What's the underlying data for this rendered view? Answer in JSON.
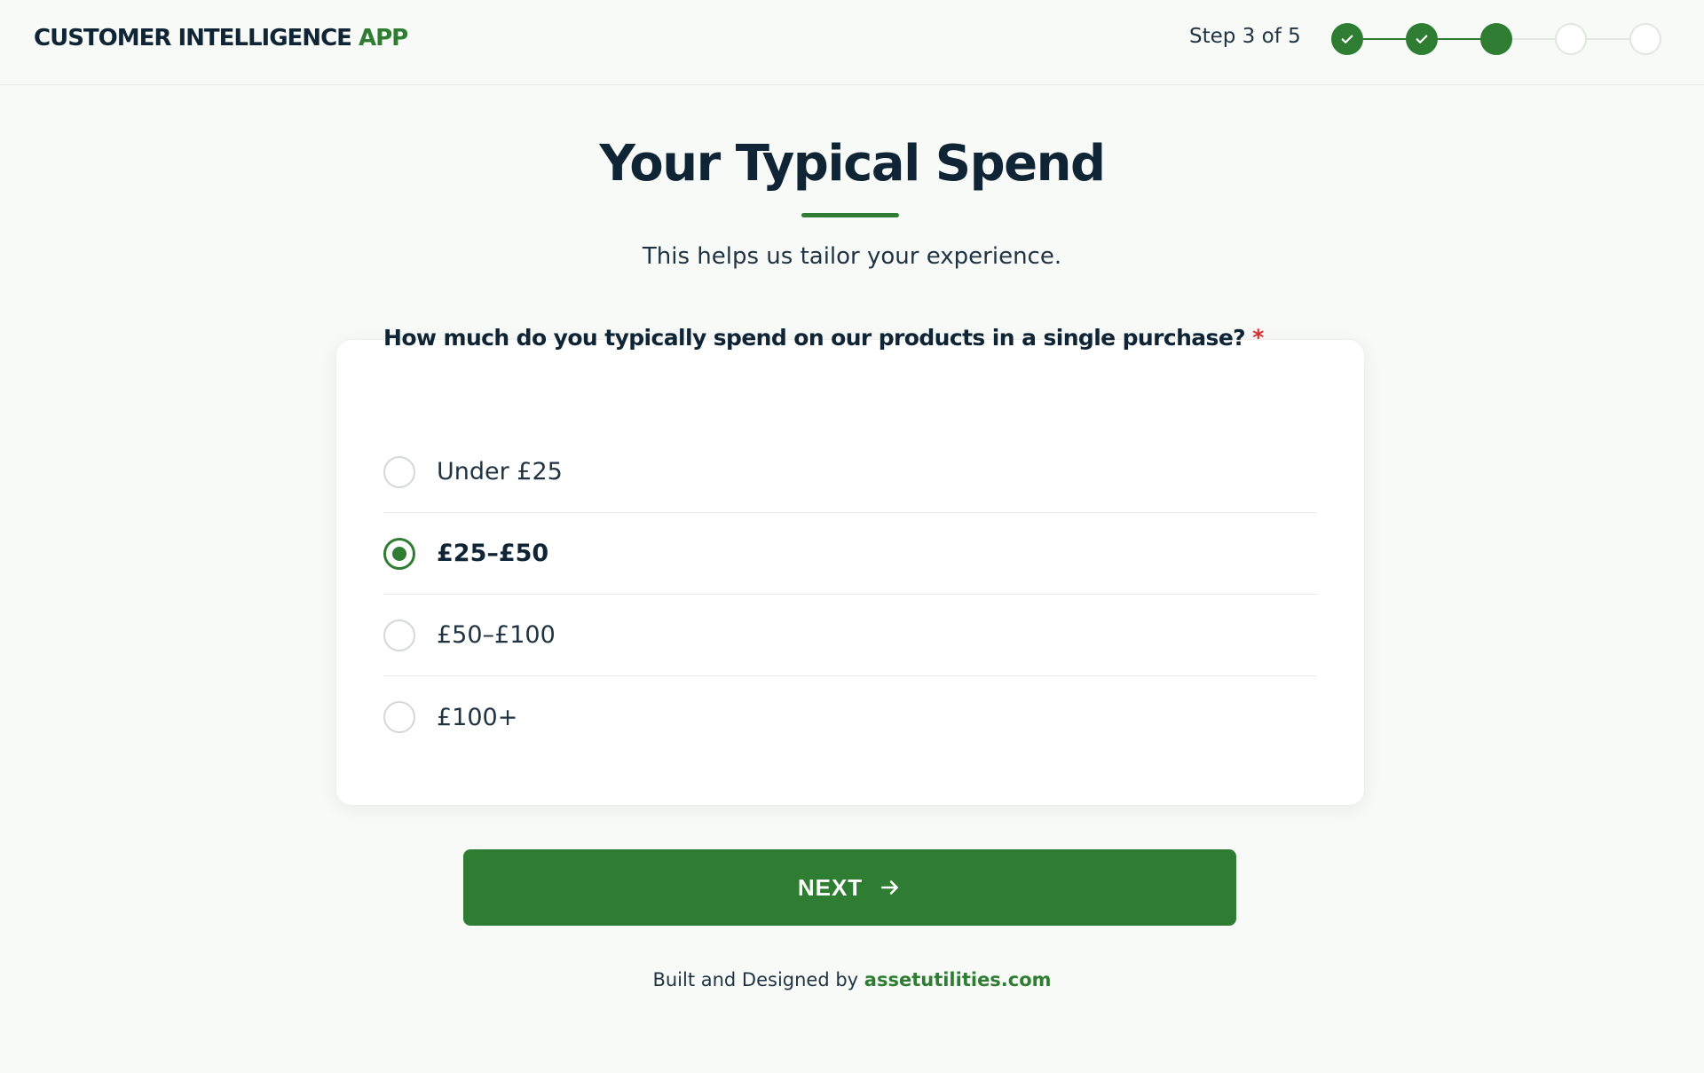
{
  "header": {
    "logo_main": "CUSTOMER INTELLIGENCE",
    "logo_accent": "APP",
    "step_label": "Step 3 of 5",
    "steps": [
      {
        "status": "done"
      },
      {
        "status": "done"
      },
      {
        "status": "current"
      },
      {
        "status": "pending"
      },
      {
        "status": "pending"
      }
    ]
  },
  "page": {
    "title": "Your Typical Spend",
    "subtitle": "This helps us tailor your experience."
  },
  "question": {
    "text": "How much do you typically spend on our products in a single purchase?",
    "required_mark": "*",
    "options": [
      {
        "label": "Under £25",
        "selected": false
      },
      {
        "label": "£25–£50",
        "selected": true
      },
      {
        "label": "£50–£100",
        "selected": false
      },
      {
        "label": "£100+",
        "selected": false
      }
    ]
  },
  "actions": {
    "next_label": "NEXT"
  },
  "footer": {
    "prefix": "Built and Designed by",
    "link_text": "assetutilities.com"
  },
  "colors": {
    "accent": "#2f7d32",
    "text": "#0f2536",
    "required": "#d32f2f",
    "background": "#f8faf8"
  }
}
